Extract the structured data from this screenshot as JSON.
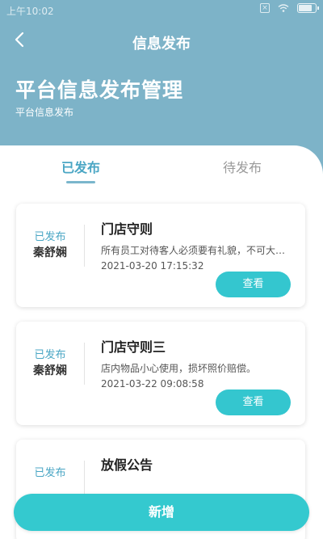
{
  "statusbar": {
    "time": "上午10:02"
  },
  "header": {
    "nav_title": "信息发布",
    "title": "平台信息发布管理",
    "subtitle": "平台信息发布"
  },
  "tabs": [
    {
      "label": "已发布",
      "active": true
    },
    {
      "label": "待发布",
      "active": false
    }
  ],
  "posts": [
    {
      "status": "已发布",
      "author": "秦舒娴",
      "title": "门店守则",
      "desc": "所有员工对待客人必须要有礼貌，不可大声喧哗",
      "time": "2021-03-20 17:15:32",
      "button": "查看"
    },
    {
      "status": "已发布",
      "author": "秦舒娴",
      "title": "门店守则三",
      "desc": "店内物品小心使用，损坏照价赔偿。",
      "time": "2021-03-22 09:08:58",
      "button": "查看"
    },
    {
      "status": "已发布",
      "author": "",
      "title": "放假公告",
      "desc": "",
      "time": "",
      "button": ""
    }
  ],
  "footer": {
    "add_label": "新增"
  },
  "colors": {
    "header": "#7db3c8",
    "accent": "#34c6cf",
    "tab_active": "#4aa6c4"
  }
}
